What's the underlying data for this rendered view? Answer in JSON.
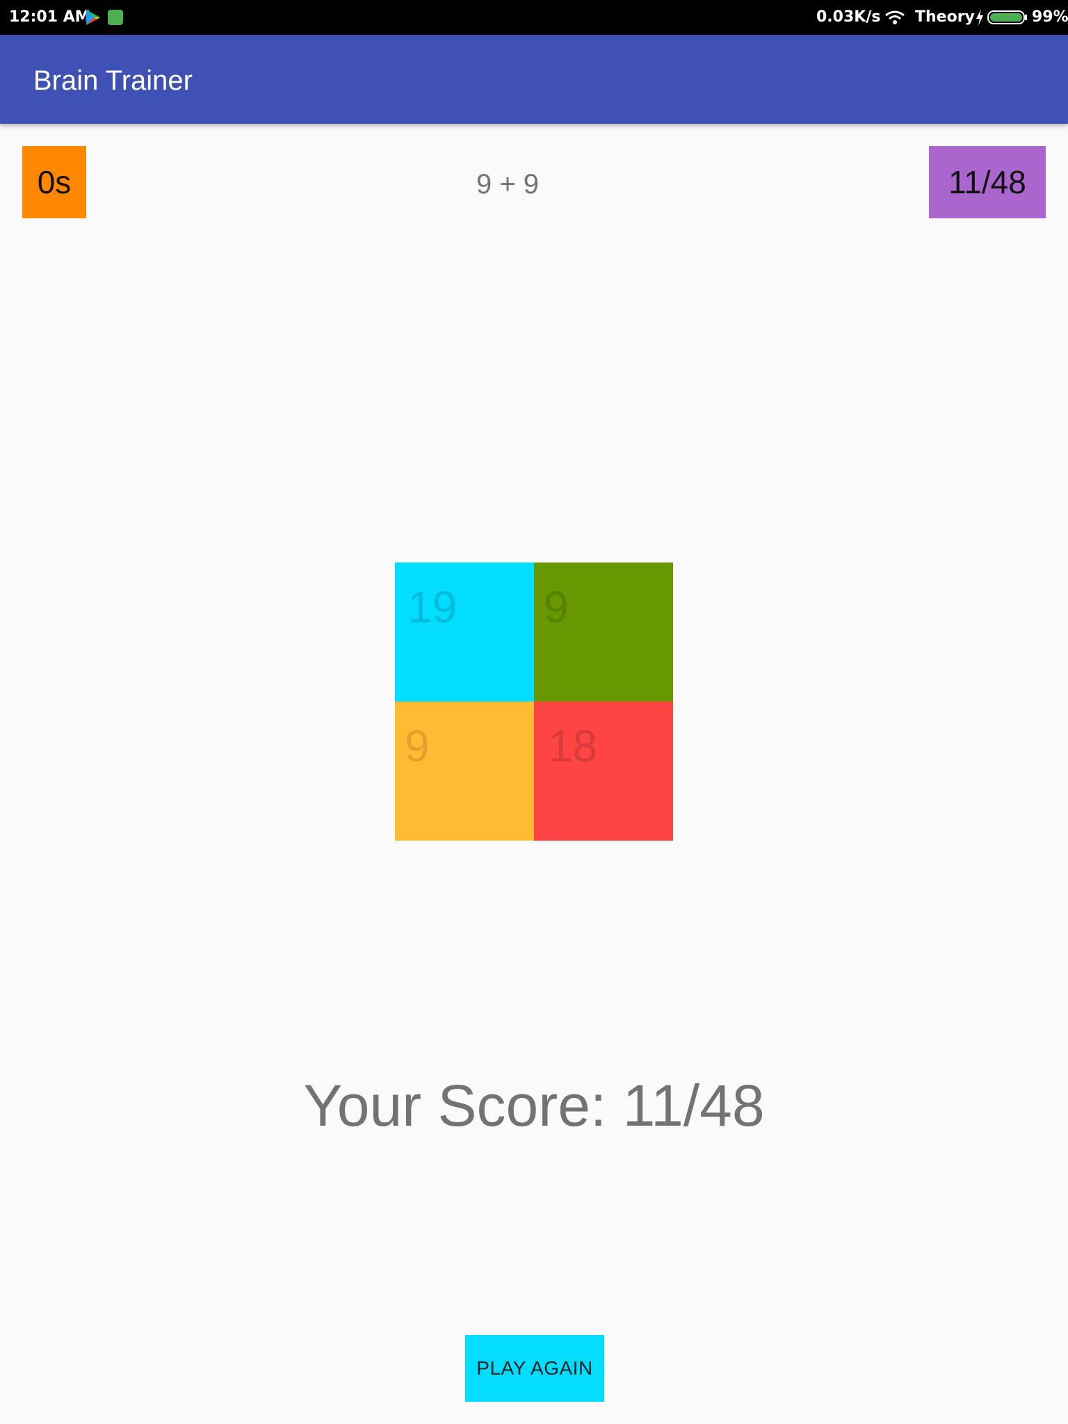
{
  "status_bar": {
    "time": "12:01 AM",
    "net_speed": "0.03K/s",
    "carrier": "Theory",
    "battery": "99%",
    "icons": [
      "play-store-icon",
      "android-icon",
      "wifi-icon",
      "charging-bolt-icon",
      "battery-icon"
    ]
  },
  "app_bar": {
    "title": "Brain Trainer",
    "color": "#3f51b5"
  },
  "game": {
    "timer": "0s",
    "question": "9 + 9",
    "score": "11/48",
    "answers": [
      {
        "label": "19",
        "color": "#00ddff"
      },
      {
        "label": "9",
        "color": "#669900"
      },
      {
        "label": "9",
        "color": "#ffbb33"
      },
      {
        "label": "18",
        "color": "#ff4444"
      }
    ],
    "result": "Your Score: 11/48",
    "play_again_label": "PLAY AGAIN"
  },
  "colors": {
    "timer": "#ff8800",
    "score_badge": "#aa66cc",
    "play_again": "#00ddff",
    "background": "#fafafa"
  }
}
